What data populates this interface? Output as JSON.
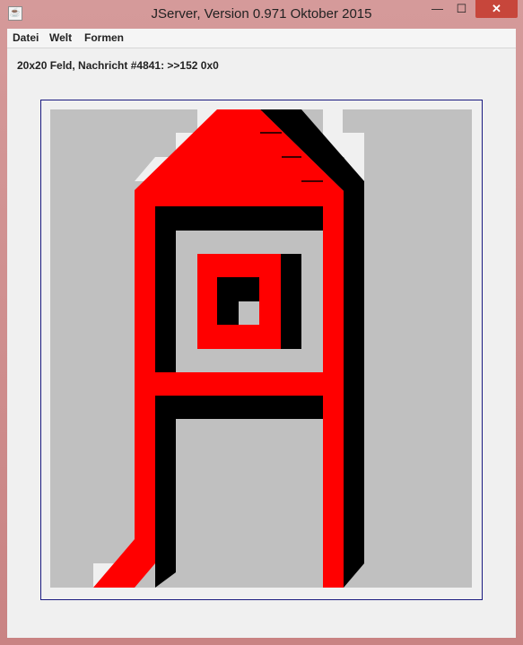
{
  "window": {
    "title": "JServer, Version 0.971 Oktober 2015",
    "app_icon": "java-cup-icon",
    "controls": {
      "minimize": "—",
      "maximize": "☐",
      "close": "✕"
    }
  },
  "menubar": {
    "items": [
      {
        "label": "Datei"
      },
      {
        "label": "Welt"
      },
      {
        "label": "Formen"
      }
    ]
  },
  "status": {
    "text": "20x20 Feld, Nachricht #4841: >>152 0x0"
  },
  "colors": {
    "cell_gray": "#c0c0c0",
    "cell_white": "#f0f0f0",
    "red": "#ff0000",
    "black": "#000000",
    "frame": "#1a1a80"
  }
}
